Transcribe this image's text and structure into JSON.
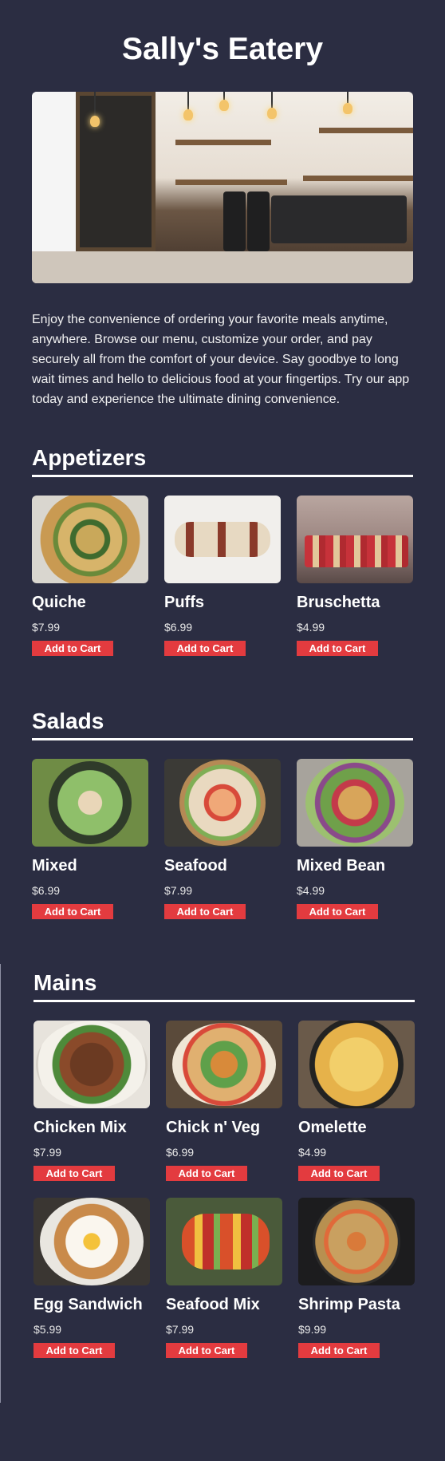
{
  "page": {
    "title": "Sally's Eatery",
    "intro": "Enjoy the convenience of ordering your favorite meals anytime, anywhere. Browse our menu, customize your order, and pay securely all from the comfort of your device. Say goodbye to long wait times and hello to delicious food at your fingertips. Try our app today and experience the ultimate dining convenience."
  },
  "colors": {
    "background": "#2b2d42",
    "button": "#e33b3f",
    "text": "#ffffff"
  },
  "sections": [
    {
      "title": "Appetizers",
      "items": [
        {
          "name": "Quiche",
          "price": "$7.99",
          "button": "Add to Cart"
        },
        {
          "name": "Puffs",
          "price": "$6.99",
          "button": "Add to Cart"
        },
        {
          "name": "Bruschetta",
          "price": "$4.99",
          "button": "Add to Cart"
        }
      ]
    },
    {
      "title": "Salads",
      "items": [
        {
          "name": "Mixed",
          "price": "$6.99",
          "button": "Add to Cart"
        },
        {
          "name": "Seafood",
          "price": "$7.99",
          "button": "Add to Cart"
        },
        {
          "name": "Mixed Bean",
          "price": "$4.99",
          "button": "Add to Cart"
        }
      ]
    },
    {
      "title": "Mains",
      "items": [
        {
          "name": "Chicken Mix",
          "price": "$7.99",
          "button": "Add to Cart"
        },
        {
          "name": "Chick n' Veg",
          "price": "$6.99",
          "button": "Add to Cart"
        },
        {
          "name": "Omelette",
          "price": "$4.99",
          "button": "Add to Cart"
        },
        {
          "name": "Egg Sandwich",
          "price": "$5.99",
          "button": "Add to Cart"
        },
        {
          "name": "Seafood Mix",
          "price": "$7.99",
          "button": "Add to Cart"
        },
        {
          "name": "Shrimp Pasta",
          "price": "$9.99",
          "button": "Add to Cart"
        }
      ]
    }
  ]
}
